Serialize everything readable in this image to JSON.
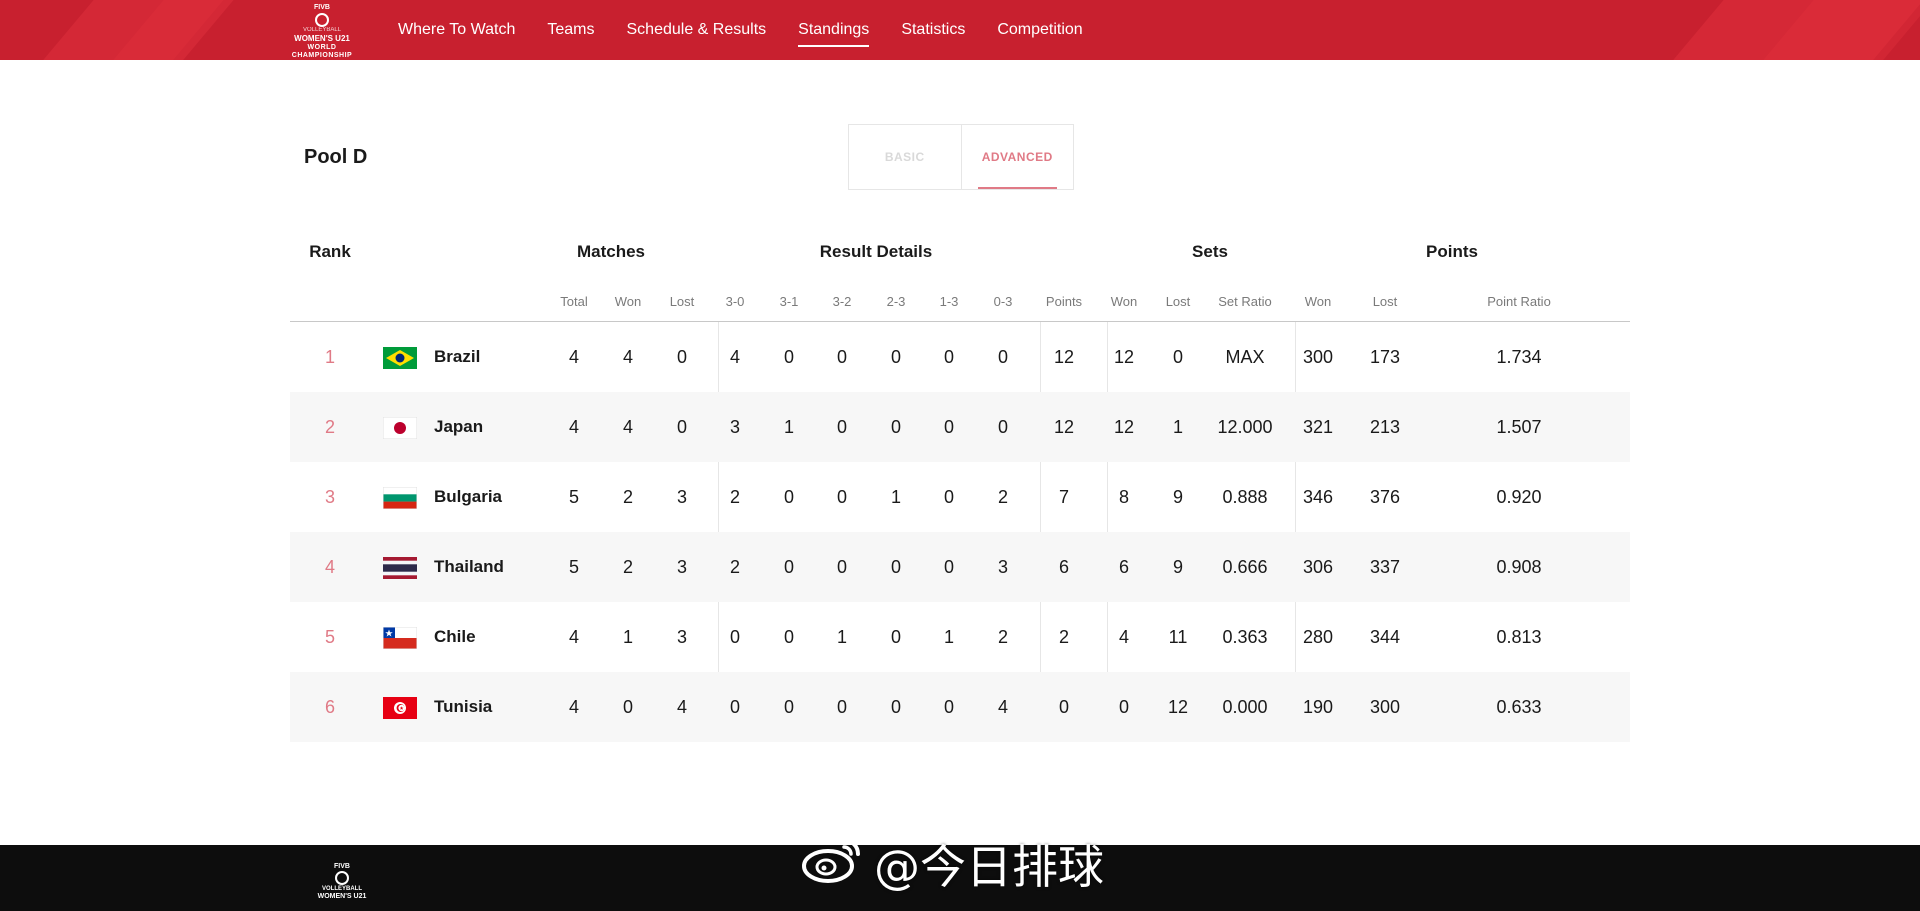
{
  "brand": {
    "logo_line1": "FIVB",
    "logo_line2": "VOLLEYBALL",
    "logo_line3": "WOMEN'S U21",
    "logo_line4": "WORLD CHAMPIONSHIP"
  },
  "nav": [
    {
      "label": "Where To Watch",
      "active": false
    },
    {
      "label": "Teams",
      "active": false
    },
    {
      "label": "Schedule & Results",
      "active": false
    },
    {
      "label": "Standings",
      "active": true
    },
    {
      "label": "Statistics",
      "active": false
    },
    {
      "label": "Competition",
      "active": false
    }
  ],
  "pool": {
    "title": "Pool D"
  },
  "toggle": {
    "basic": "BASIC",
    "advanced": "ADVANCED",
    "selected": "advanced"
  },
  "groups": {
    "rank": "Rank",
    "matches": "Matches",
    "result_details": "Result Details",
    "sets": "Sets",
    "points": "Points"
  },
  "subheaders": {
    "total": "Total",
    "won": "Won",
    "lost": "Lost",
    "r30": "3-0",
    "r31": "3-1",
    "r32": "3-2",
    "r23": "2-3",
    "r13": "1-3",
    "r03": "0-3",
    "points": "Points",
    "sets_won": "Won",
    "sets_lost": "Lost",
    "set_ratio": "Set Ratio",
    "pts_won": "Won",
    "pts_lost": "Lost",
    "point_ratio": "Point Ratio"
  },
  "standings": [
    {
      "rank": "1",
      "team": "Brazil",
      "flag": "brazil-flag-icon",
      "total": "4",
      "won": "4",
      "lost": "0",
      "r30": "4",
      "r31": "0",
      "r32": "0",
      "r23": "0",
      "r13": "0",
      "r03": "0",
      "points": "12",
      "sets_won": "12",
      "sets_lost": "0",
      "set_ratio": "MAX",
      "pts_won": "300",
      "pts_lost": "173",
      "point_ratio": "1.734"
    },
    {
      "rank": "2",
      "team": "Japan",
      "flag": "japan-flag-icon",
      "total": "4",
      "won": "4",
      "lost": "0",
      "r30": "3",
      "r31": "1",
      "r32": "0",
      "r23": "0",
      "r13": "0",
      "r03": "0",
      "points": "12",
      "sets_won": "12",
      "sets_lost": "1",
      "set_ratio": "12.000",
      "pts_won": "321",
      "pts_lost": "213",
      "point_ratio": "1.507"
    },
    {
      "rank": "3",
      "team": "Bulgaria",
      "flag": "bulgaria-flag-icon",
      "total": "5",
      "won": "2",
      "lost": "3",
      "r30": "2",
      "r31": "0",
      "r32": "0",
      "r23": "1",
      "r13": "0",
      "r03": "2",
      "points": "7",
      "sets_won": "8",
      "sets_lost": "9",
      "set_ratio": "0.888",
      "pts_won": "346",
      "pts_lost": "376",
      "point_ratio": "0.920"
    },
    {
      "rank": "4",
      "team": "Thailand",
      "flag": "thailand-flag-icon",
      "total": "5",
      "won": "2",
      "lost": "3",
      "r30": "2",
      "r31": "0",
      "r32": "0",
      "r23": "0",
      "r13": "0",
      "r03": "3",
      "points": "6",
      "sets_won": "6",
      "sets_lost": "9",
      "set_ratio": "0.666",
      "pts_won": "306",
      "pts_lost": "337",
      "point_ratio": "0.908"
    },
    {
      "rank": "5",
      "team": "Chile",
      "flag": "chile-flag-icon",
      "total": "4",
      "won": "1",
      "lost": "3",
      "r30": "0",
      "r31": "0",
      "r32": "1",
      "r23": "0",
      "r13": "1",
      "r03": "2",
      "points": "2",
      "sets_won": "4",
      "sets_lost": "11",
      "set_ratio": "0.363",
      "pts_won": "280",
      "pts_lost": "344",
      "point_ratio": "0.813"
    },
    {
      "rank": "6",
      "team": "Tunisia",
      "flag": "tunisia-flag-icon",
      "total": "4",
      "won": "0",
      "lost": "4",
      "r30": "0",
      "r31": "0",
      "r32": "0",
      "r23": "0",
      "r13": "0",
      "r03": "4",
      "points": "0",
      "sets_won": "0",
      "sets_lost": "12",
      "set_ratio": "0.000",
      "pts_won": "190",
      "pts_lost": "300",
      "point_ratio": "0.633"
    }
  ],
  "watermark": {
    "text": "@今日排球",
    "icon": "weibo-icon"
  },
  "colors": {
    "header_red": "#c8202f",
    "rank_pink": "#e07a86",
    "footer": "#0d0d0d"
  }
}
